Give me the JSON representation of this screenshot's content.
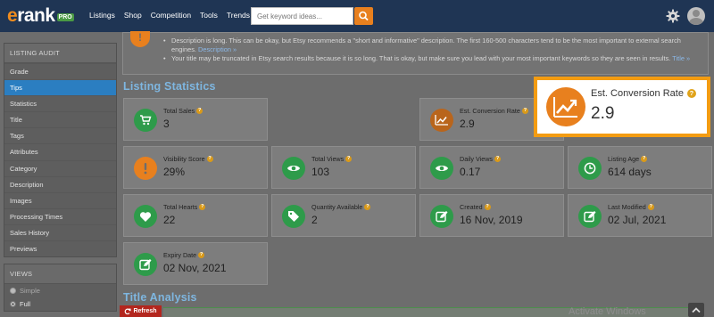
{
  "nav": {
    "logo": "erank",
    "logo_badge": "PRO",
    "links": [
      "Listings",
      "Shop",
      "Competition",
      "Tools",
      "Trends"
    ],
    "search_placeholder": "Get keyword ideas..."
  },
  "sidebar": {
    "audit_header": "LISTING AUDIT",
    "items": [
      "Grade",
      "Tips",
      "Statistics",
      "Title",
      "Tags",
      "Attributes",
      "Category",
      "Description",
      "Images",
      "Processing Times",
      "Sales History",
      "Previews"
    ],
    "active_item": "Tips",
    "views_header": "VIEWS",
    "views_options": [
      "Simple",
      "Full"
    ],
    "views_selected": "Full"
  },
  "tips": {
    "line1": "Description is long. This can be okay, but Etsy recommends a \"short and informative\" description. The first 160-500 characters tend to be the most important to external search engines.",
    "line1_link": "Description",
    "line2": "Your title may be truncated in Etsy search results because it is so long. That is okay, but make sure you lead with your most important keywords so they are seen in results.",
    "line2_link": "Title"
  },
  "listing_statistics": {
    "title": "Listing Statistics",
    "cards": [
      {
        "label": "Total Sales",
        "value": "3",
        "icon": "cart-icon",
        "color": "green"
      },
      {
        "label": "Est. Conversion Rate",
        "value": "2.9",
        "icon": "trend-up-icon",
        "color": "brown"
      },
      {
        "label": "Visibility Score",
        "value": "29%",
        "icon": "exclamation-icon",
        "color": "orange"
      },
      {
        "label": "Total Views",
        "value": "103",
        "icon": "eye-icon",
        "color": "green"
      },
      {
        "label": "Daily Views",
        "value": "0.17",
        "icon": "eye-icon",
        "color": "green"
      },
      {
        "label": "Listing Age",
        "value": "614 days",
        "icon": "clock-icon",
        "color": "green"
      },
      {
        "label": "Total Hearts",
        "value": "22",
        "icon": "heart-icon",
        "color": "green"
      },
      {
        "label": "Quantity Available",
        "value": "2",
        "icon": "tag-icon",
        "color": "green"
      },
      {
        "label": "Created",
        "value": "16 Nov, 2019",
        "icon": "edit-icon",
        "color": "green"
      },
      {
        "label": "Last Modified",
        "value": "02 Jul, 2021",
        "icon": "edit-icon",
        "color": "green"
      },
      {
        "label": "Expiry Date",
        "value": "02 Nov, 2021",
        "icon": "edit-icon",
        "color": "green"
      }
    ],
    "highlight": {
      "label": "Est. Conversion Rate",
      "value": "2.9"
    }
  },
  "title_analysis": {
    "title": "Title Analysis"
  },
  "refresh_label": "Refresh",
  "watermark": "Activate Windows",
  "colors": {
    "accent": "#f39c12",
    "nav": "#1f3554",
    "active": "#2b7ec1",
    "green": "#2e9b4a",
    "orange": "#e8801e"
  }
}
